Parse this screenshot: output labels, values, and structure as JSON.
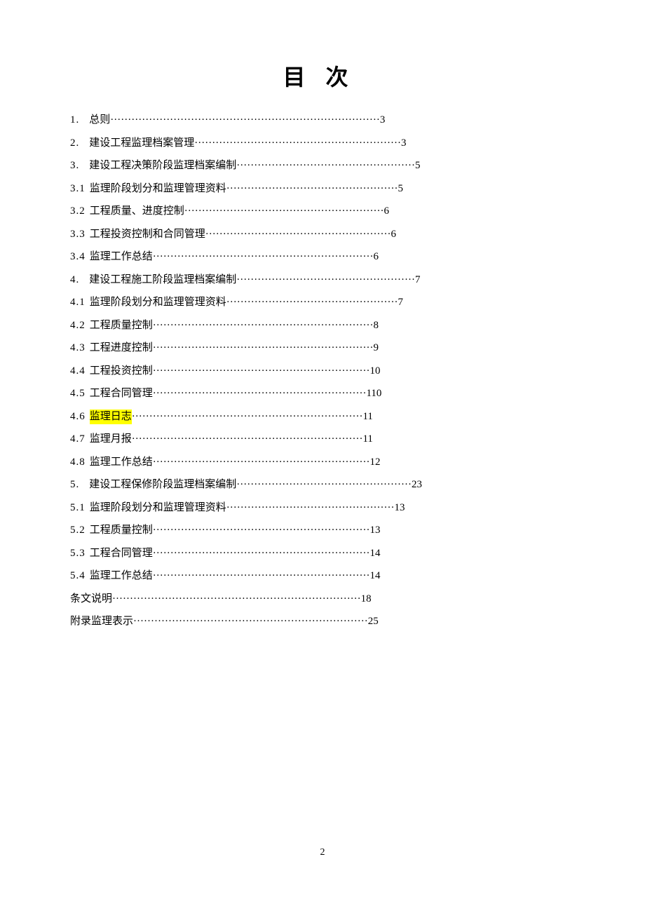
{
  "title": "目 次",
  "footer_page": "2",
  "toc": [
    {
      "num": "1.",
      "gap": "wide",
      "label": "总则",
      "dots": 77,
      "page": "3",
      "hl": false
    },
    {
      "num": "2.",
      "gap": "wide",
      "label": "建设工程监理档案管理",
      "dots": 59,
      "page": "3",
      "hl": false
    },
    {
      "num": "3.",
      "gap": "wide",
      "label": "建设工程决策阶段监理档案编制",
      "dots": 51,
      "page": "5",
      "hl": false
    },
    {
      "num": "3.1",
      "gap": "narrow",
      "label": "监理阶段划分和监理管理资料",
      "dots": 49,
      "page": "5",
      "hl": false
    },
    {
      "num": "3.2",
      "gap": "narrow",
      "label": "工程质量、进度控制",
      "dots": 57,
      "page": "6",
      "hl": false
    },
    {
      "num": "3.3",
      "gap": "narrow",
      "label": "工程投资控制和合同管理",
      "dots": 53,
      "page": "6",
      "hl": false
    },
    {
      "num": "3.4",
      "gap": "narrow",
      "label": "监理工作总结",
      "dots": 63,
      "page": "6",
      "hl": false
    },
    {
      "num": "4.",
      "gap": "wide",
      "label": "建设工程施工阶段监理档案编制",
      "dots": 51,
      "page": "7",
      "hl": false
    },
    {
      "num": "4.1",
      "gap": "narrow",
      "label": "监理阶段划分和监理管理资料",
      "dots": 49,
      "page": "7",
      "hl": false
    },
    {
      "num": "4.2",
      "gap": "narrow",
      "label": "工程质量控制",
      "dots": 63,
      "page": "8",
      "hl": false
    },
    {
      "num": "4.3",
      "gap": "narrow",
      "label": "工程进度控制",
      "dots": 63,
      "page": "9",
      "hl": false
    },
    {
      "num": "4.4",
      "gap": "narrow",
      "label": "工程投资控制",
      "dots": 62,
      "page": "10",
      "hl": false
    },
    {
      "num": "4.5",
      "gap": "narrow",
      "label": "工程合同管理",
      "dots": 61,
      "page": "110",
      "hl": false
    },
    {
      "num": "4.6",
      "gap": "narrow",
      "label": "监理日志",
      "dots": 66,
      "page": "11",
      "hl": true
    },
    {
      "num": "4.7",
      "gap": "narrow",
      "label": "监理月报",
      "dots": 66,
      "page": "11",
      "hl": false
    },
    {
      "num": "4.8",
      "gap": "narrow",
      "label": "监理工作总结",
      "dots": 62,
      "page": "12",
      "hl": false
    },
    {
      "num": "5.",
      "gap": "wide",
      "label": "建设工程保修阶段监理档案编制",
      "dots": 50,
      "page": "23",
      "hl": false
    },
    {
      "num": "5.1",
      "gap": "narrow",
      "label": "监理阶段划分和监理管理资料",
      "dots": 48,
      "page": "13",
      "hl": false
    },
    {
      "num": "5.2",
      "gap": "narrow",
      "label": "工程质量控制",
      "dots": 62,
      "page": "13",
      "hl": false
    },
    {
      "num": "5.3",
      "gap": "narrow",
      "label": "工程合同管理",
      "dots": 62,
      "page": "14",
      "hl": false
    },
    {
      "num": "5.4",
      "gap": "narrow",
      "label": "监理工作总结",
      "dots": 62,
      "page": "14",
      "hl": false
    },
    {
      "num": "",
      "gap": "none",
      "label": "条文说明",
      "dots": 71,
      "page": "18",
      "hl": false
    },
    {
      "num": "",
      "gap": "none",
      "label": "附录监理表示",
      "dots": 67,
      "page": "25",
      "hl": false
    }
  ]
}
